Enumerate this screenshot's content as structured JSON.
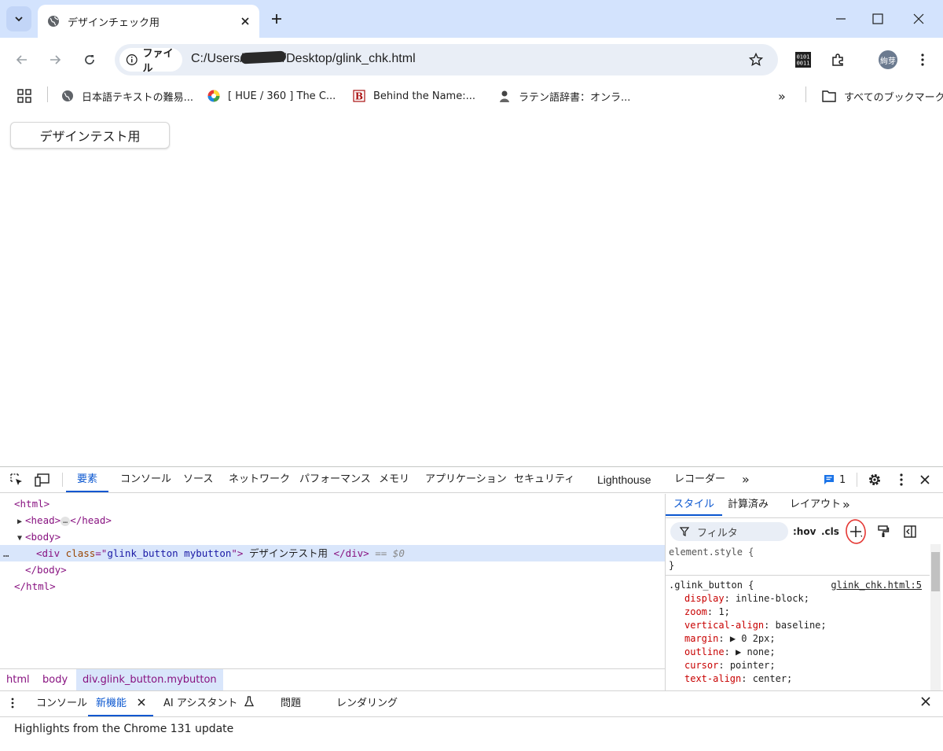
{
  "tab": {
    "title": "デザインチェック用"
  },
  "omnibox": {
    "chip_label": "ファイル",
    "url_prefix": "C:/Users/",
    "url_suffix": "/Desktop/glink_chk.html"
  },
  "profile": {
    "avatar_text": "絢芽"
  },
  "bookmarks": {
    "items": [
      {
        "label": "日本語テキストの難易..."
      },
      {
        "label": "[ HUE / 360 ] The C..."
      },
      {
        "label": "Behind the Name:..."
      },
      {
        "label": "ラテン語辞書：オンラ..."
      }
    ],
    "all_bookmarks": "すべてのブックマーク",
    "overflow": "»"
  },
  "page": {
    "button_label": "デザインテスト用"
  },
  "devtools": {
    "tabs": [
      "要素",
      "コンソール",
      "ソース",
      "ネットワーク",
      "パフォーマンス",
      "メモリ",
      "アプリケーション",
      "セキュリティ",
      "Lighthouse",
      "レコーダー"
    ],
    "more": "»",
    "issues_count": "1",
    "dom": {
      "html_open": "<html>",
      "head": "<head>",
      "head_close": "</head>",
      "ellipsis": "…",
      "body_open": "<body>",
      "div_tag": "<div",
      "div_attr": "class",
      "div_attr_eq": "=\"",
      "div_attr_value": "glink_button mybutton",
      "div_attr_end": "\">",
      "div_text": "デザインテスト用",
      "div_close": "</div>",
      "eq": "== $0",
      "body_close": "</body>",
      "html_close": "</html>",
      "dots": "…"
    },
    "breadcrumbs": [
      "html",
      "body",
      "div.glink_button.mybutton"
    ],
    "styles": {
      "tabs": [
        "スタイル",
        "計算済み",
        "レイアウト"
      ],
      "more": "»",
      "filter_placeholder": "フィルタ",
      "hov": ":hov",
      "cls": ".cls",
      "element_style": "element.style {",
      "close_brace": "}",
      "rule_selector": ".glink_button {",
      "rule_source": "glink_chk.html:5",
      "props": [
        {
          "name": "display",
          "value": "inline-block;"
        },
        {
          "name": "zoom",
          "value": "1;"
        },
        {
          "name": "vertical-align",
          "value": "baseline;"
        },
        {
          "name": "margin",
          "value": "▶ 0 2px;"
        },
        {
          "name": "outline",
          "value": "▶ none;"
        },
        {
          "name": "cursor",
          "value": "pointer;"
        },
        {
          "name": "text-align",
          "value": "center;"
        }
      ]
    },
    "drawer": {
      "tabs": [
        "コンソール",
        "新機能",
        "AI アシスタント",
        "問題",
        "レンダリング"
      ],
      "content": "Highlights from the Chrome 131 update"
    }
  },
  "colors": {
    "accent": "#0b57d0",
    "tabstrip": "#d3e3fd",
    "omnibox": "#e9eef6",
    "selection": "#d9e6fb",
    "highlight_circle": "#e53935"
  }
}
